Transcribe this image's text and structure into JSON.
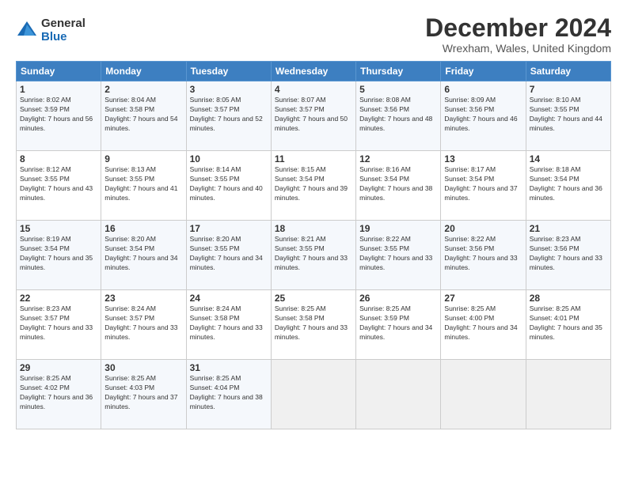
{
  "logo": {
    "general": "General",
    "blue": "Blue"
  },
  "title": "December 2024",
  "location": "Wrexham, Wales, United Kingdom",
  "headers": [
    "Sunday",
    "Monday",
    "Tuesday",
    "Wednesday",
    "Thursday",
    "Friday",
    "Saturday"
  ],
  "weeks": [
    [
      {
        "day": "1",
        "sunrise": "8:02 AM",
        "sunset": "3:59 PM",
        "daylight": "7 hours and 56 minutes."
      },
      {
        "day": "2",
        "sunrise": "8:04 AM",
        "sunset": "3:58 PM",
        "daylight": "7 hours and 54 minutes."
      },
      {
        "day": "3",
        "sunrise": "8:05 AM",
        "sunset": "3:57 PM",
        "daylight": "7 hours and 52 minutes."
      },
      {
        "day": "4",
        "sunrise": "8:07 AM",
        "sunset": "3:57 PM",
        "daylight": "7 hours and 50 minutes."
      },
      {
        "day": "5",
        "sunrise": "8:08 AM",
        "sunset": "3:56 PM",
        "daylight": "7 hours and 48 minutes."
      },
      {
        "day": "6",
        "sunrise": "8:09 AM",
        "sunset": "3:56 PM",
        "daylight": "7 hours and 46 minutes."
      },
      {
        "day": "7",
        "sunrise": "8:10 AM",
        "sunset": "3:55 PM",
        "daylight": "7 hours and 44 minutes."
      }
    ],
    [
      {
        "day": "8",
        "sunrise": "8:12 AM",
        "sunset": "3:55 PM",
        "daylight": "7 hours and 43 minutes."
      },
      {
        "day": "9",
        "sunrise": "8:13 AM",
        "sunset": "3:55 PM",
        "daylight": "7 hours and 41 minutes."
      },
      {
        "day": "10",
        "sunrise": "8:14 AM",
        "sunset": "3:55 PM",
        "daylight": "7 hours and 40 minutes."
      },
      {
        "day": "11",
        "sunrise": "8:15 AM",
        "sunset": "3:54 PM",
        "daylight": "7 hours and 39 minutes."
      },
      {
        "day": "12",
        "sunrise": "8:16 AM",
        "sunset": "3:54 PM",
        "daylight": "7 hours and 38 minutes."
      },
      {
        "day": "13",
        "sunrise": "8:17 AM",
        "sunset": "3:54 PM",
        "daylight": "7 hours and 37 minutes."
      },
      {
        "day": "14",
        "sunrise": "8:18 AM",
        "sunset": "3:54 PM",
        "daylight": "7 hours and 36 minutes."
      }
    ],
    [
      {
        "day": "15",
        "sunrise": "8:19 AM",
        "sunset": "3:54 PM",
        "daylight": "7 hours and 35 minutes."
      },
      {
        "day": "16",
        "sunrise": "8:20 AM",
        "sunset": "3:54 PM",
        "daylight": "7 hours and 34 minutes."
      },
      {
        "day": "17",
        "sunrise": "8:20 AM",
        "sunset": "3:55 PM",
        "daylight": "7 hours and 34 minutes."
      },
      {
        "day": "18",
        "sunrise": "8:21 AM",
        "sunset": "3:55 PM",
        "daylight": "7 hours and 33 minutes."
      },
      {
        "day": "19",
        "sunrise": "8:22 AM",
        "sunset": "3:55 PM",
        "daylight": "7 hours and 33 minutes."
      },
      {
        "day": "20",
        "sunrise": "8:22 AM",
        "sunset": "3:56 PM",
        "daylight": "7 hours and 33 minutes."
      },
      {
        "day": "21",
        "sunrise": "8:23 AM",
        "sunset": "3:56 PM",
        "daylight": "7 hours and 33 minutes."
      }
    ],
    [
      {
        "day": "22",
        "sunrise": "8:23 AM",
        "sunset": "3:57 PM",
        "daylight": "7 hours and 33 minutes."
      },
      {
        "day": "23",
        "sunrise": "8:24 AM",
        "sunset": "3:57 PM",
        "daylight": "7 hours and 33 minutes."
      },
      {
        "day": "24",
        "sunrise": "8:24 AM",
        "sunset": "3:58 PM",
        "daylight": "7 hours and 33 minutes."
      },
      {
        "day": "25",
        "sunrise": "8:25 AM",
        "sunset": "3:58 PM",
        "daylight": "7 hours and 33 minutes."
      },
      {
        "day": "26",
        "sunrise": "8:25 AM",
        "sunset": "3:59 PM",
        "daylight": "7 hours and 34 minutes."
      },
      {
        "day": "27",
        "sunrise": "8:25 AM",
        "sunset": "4:00 PM",
        "daylight": "7 hours and 34 minutes."
      },
      {
        "day": "28",
        "sunrise": "8:25 AM",
        "sunset": "4:01 PM",
        "daylight": "7 hours and 35 minutes."
      }
    ],
    [
      {
        "day": "29",
        "sunrise": "8:25 AM",
        "sunset": "4:02 PM",
        "daylight": "7 hours and 36 minutes."
      },
      {
        "day": "30",
        "sunrise": "8:25 AM",
        "sunset": "4:03 PM",
        "daylight": "7 hours and 37 minutes."
      },
      {
        "day": "31",
        "sunrise": "8:25 AM",
        "sunset": "4:04 PM",
        "daylight": "7 hours and 38 minutes."
      },
      null,
      null,
      null,
      null
    ]
  ],
  "labels": {
    "sunrise": "Sunrise:",
    "sunset": "Sunset:",
    "daylight": "Daylight:"
  }
}
